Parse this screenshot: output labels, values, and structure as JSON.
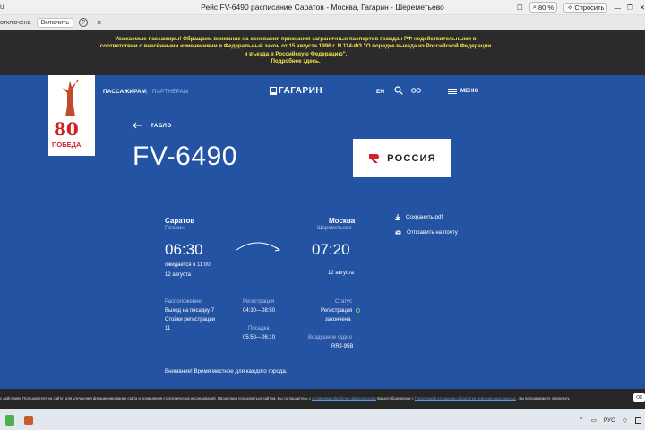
{
  "browser": {
    "left_fragment": "u",
    "title": "Рейс FV-6490 расписание Саратов - Москва, Гагарин - Шереметьево",
    "zoom": "80 %",
    "ask_label": "Спросить"
  },
  "infobar": {
    "status_text": "отключена",
    "enable_label": "Включить",
    "help_glyph": "?",
    "close_glyph": "×"
  },
  "notice": {
    "text": "Уважаемые пассажиры! Обращаем внимание на основания признания заграничных паспортов граждан РФ недействительными в соответствии с внесёнными изменениями в Федеральный закон от 15 августа 1996 г. N 114-ФЗ \"О порядке выезда из Российской Федерации и въезда в Российскую Федерацию\".",
    "more": "Подробнее здесь."
  },
  "badge": {
    "number": "80",
    "text": "ПОБЕДА!"
  },
  "nav": {
    "passengers": "ПАССАЖИРАМ",
    "separator": "|",
    "partners": "ПАРТНЕРАМ",
    "logo": "ГАГАРИН",
    "lang": "EN",
    "menu": "МЕНЮ"
  },
  "flight": {
    "back_label": "ТАБЛО",
    "number": "FV-6490",
    "airline": "РОССИЯ",
    "airline_accent": "#d2232a",
    "departure": {
      "city": "Саратов",
      "airport": "Гагарин",
      "time": "06:30",
      "expected": "ожидается в 11:00",
      "date": "12 августа"
    },
    "arrival": {
      "city": "Москва",
      "airport": "Шереметьево",
      "time": "07:20",
      "date": "12 августа"
    },
    "location_label": "Расположение",
    "location_value": "Выход на посадку 7",
    "counters_value": "Стойки регистрации",
    "counters_num": "11",
    "checkin_label": "Регистрация",
    "checkin_value": "04:30—08:50",
    "boarding_label": "Посадка",
    "boarding_value": "05:50—06:10",
    "status_label": "Статус",
    "status_value_1": "Регистрация",
    "status_value_2": "закончена",
    "aircraft_label": "Воздушное судно",
    "aircraft_value": "RRJ-95B",
    "save_pdf": "Сохранить pdf",
    "send_mail": "Отправить на почту",
    "warning": "Внимание! Время местное для каждого города."
  },
  "cookie": {
    "text_1": "с действиям Пользователя на сайте) для улучшения функционирования сайта и проведения статистических исследований. Продолжая пользоваться сайтом, Вы соглашаетесь с",
    "link_1": "условиями обработки файлов cookie",
    "text_2": "Вашего браузера и с",
    "link_2": "Политикой в отношении обработки персональных данных",
    "text_3": ". Вы всегда можете отключить",
    "ok": "ОК"
  },
  "taskbar": {
    "lang": "РУС"
  }
}
